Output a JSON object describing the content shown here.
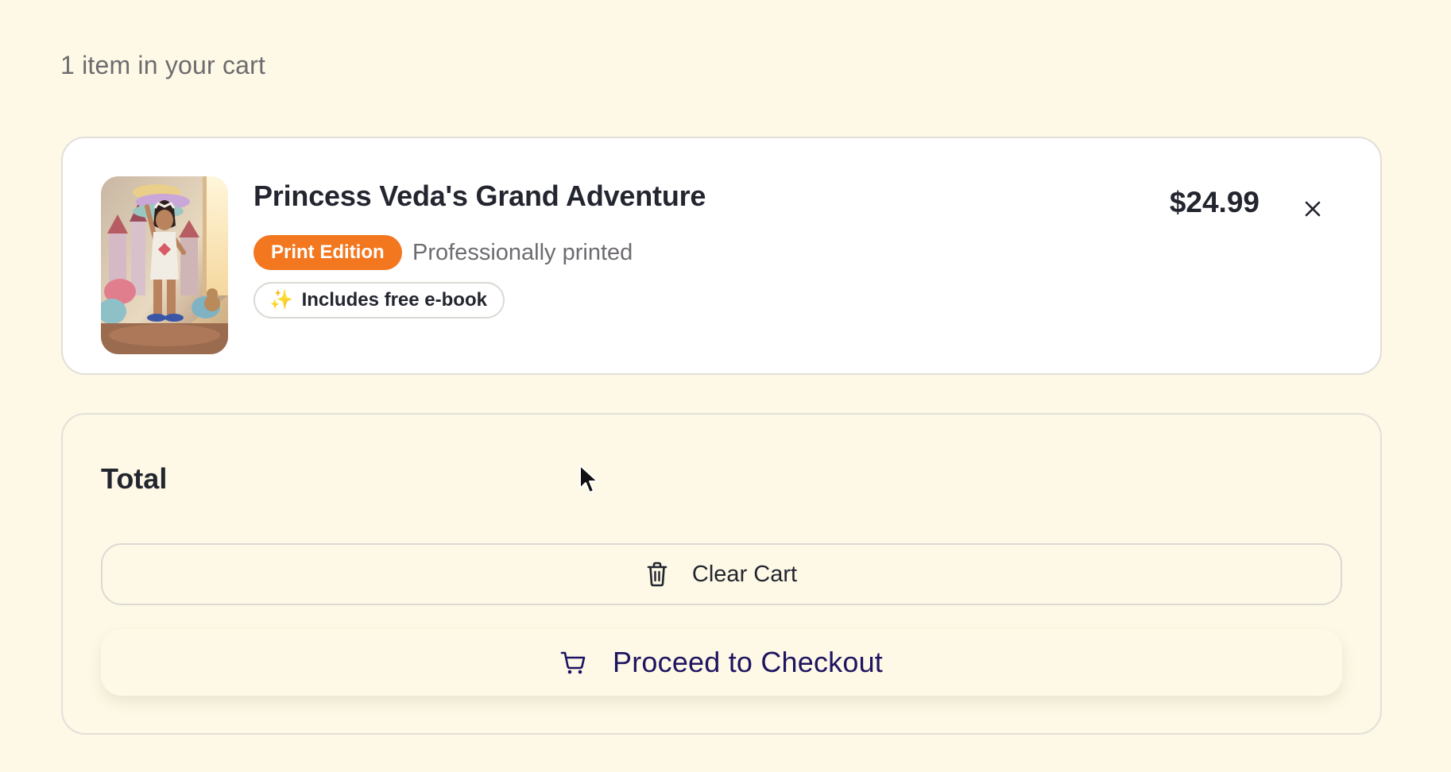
{
  "cart": {
    "summary_text": "1 item in your cart"
  },
  "item": {
    "title": "Princess Veda's Grand Adventure",
    "edition_badge": "Print Edition",
    "edition_note": "Professionally printed",
    "ebook_badge_icon": "✨",
    "ebook_badge": "Includes free e-book",
    "price": "$24.99",
    "remove_icon": "close-icon"
  },
  "summary": {
    "total_label": "Total",
    "clear_icon": "trash-icon",
    "clear_label": "Clear Cart",
    "checkout_icon": "shopping-cart-icon",
    "checkout_label": "Proceed to Checkout"
  },
  "colors": {
    "background": "#fdf9e6",
    "card": "#ffffff",
    "edition_badge": "#f3771f",
    "checkout_text": "#1e1461",
    "muted_text": "#6e6b70"
  }
}
